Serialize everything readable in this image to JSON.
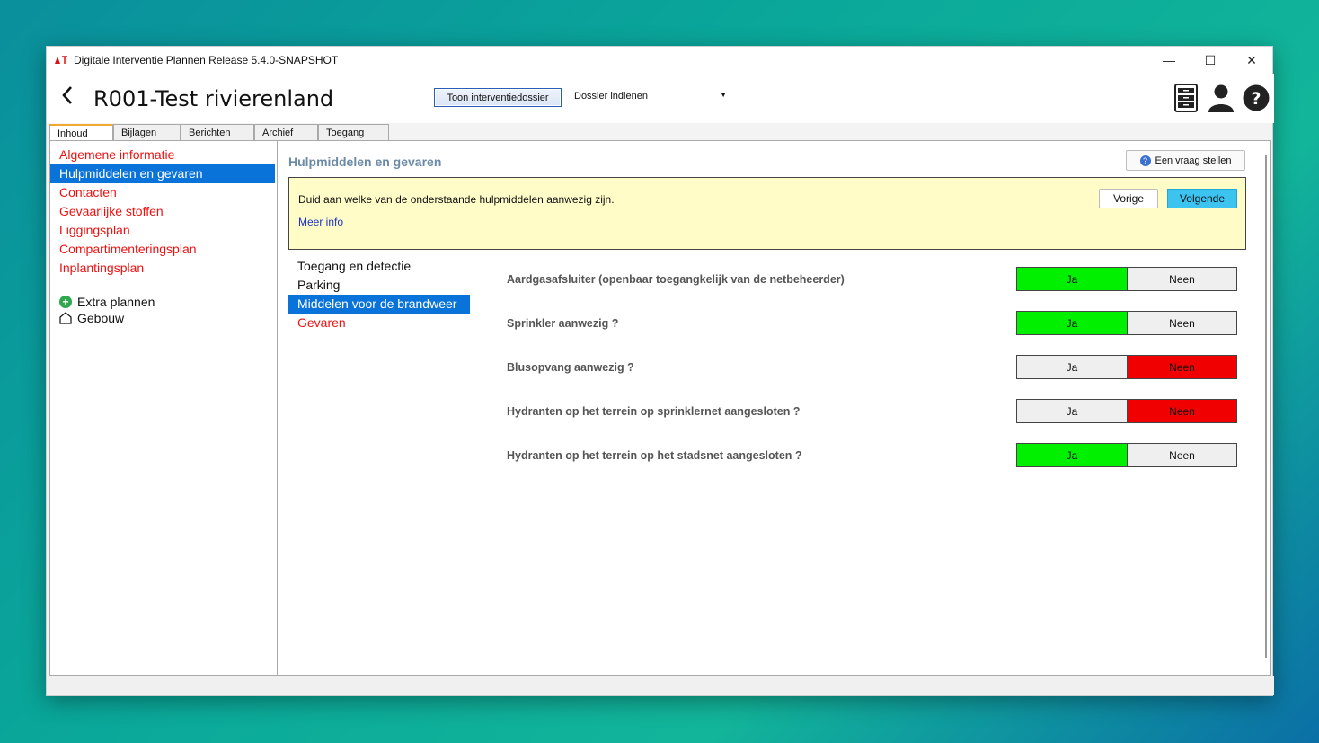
{
  "window": {
    "title": "Digitale Interventie Plannen Release 5.4.0-SNAPSHOT",
    "controls": {
      "minimize": "—",
      "maximize": "☐",
      "close": "✕"
    }
  },
  "header": {
    "back_icon": "‹",
    "title": "R001-Test rivierenland",
    "toon_button": "Toon interventiedossier",
    "dossier_select": "Dossier indienen",
    "icons": [
      "cabinet-icon",
      "user-icon",
      "help-icon"
    ]
  },
  "tabs": [
    {
      "label": "Inhoud",
      "active": true
    },
    {
      "label": "Bijlagen",
      "active": false
    },
    {
      "label": "Berichten",
      "active": false
    },
    {
      "label": "Archief",
      "active": false
    },
    {
      "label": "Toegang",
      "active": false
    }
  ],
  "left_nav": {
    "items": [
      "Algemene informatie",
      "Hulpmiddelen en gevaren",
      "Contacten",
      "Gevaarlijke stoffen",
      "Liggingsplan",
      "Compartimenteringsplan",
      "Inplantingsplan"
    ],
    "extra_plans": "Extra plannen",
    "building": "Gebouw"
  },
  "main": {
    "section_title": "Hulpmiddelen en gevaren",
    "vraag_button": "Een vraag stellen",
    "info": {
      "text": "Duid aan welke van de onderstaande hulpmiddelen aanwezig zijn.",
      "link": "Meer info",
      "prev": "Vorige",
      "next": "Volgende"
    },
    "sub_nav": [
      "Toegang en detectie",
      "Parking",
      "Middelen voor de brandweer",
      "Gevaren"
    ],
    "questions": [
      {
        "label": "Aardgasafsluiter (openbaar toegangkelijk van de netbeheerder)",
        "yes": "Ja",
        "no": "Neen",
        "answer": "ja"
      },
      {
        "label": "Sprinkler aanwezig ?",
        "yes": "Ja",
        "no": "Neen",
        "answer": "ja"
      },
      {
        "label": "Blusopvang aanwezig ?",
        "yes": "Ja",
        "no": "Neen",
        "answer": "neen"
      },
      {
        "label": "Hydranten op het terrein op sprinklernet aangesloten ?",
        "yes": "Ja",
        "no": "Neen",
        "answer": "neen"
      },
      {
        "label": "Hydranten op het terrein op het stadsnet aangesloten ?",
        "yes": "Ja",
        "no": "Neen",
        "answer": "ja"
      }
    ]
  },
  "colors": {
    "selected": "#0a73d9",
    "nav_red": "#e11111",
    "yes_green": "#00f000",
    "no_red": "#f00000",
    "next_blue": "#3cc3f0"
  }
}
